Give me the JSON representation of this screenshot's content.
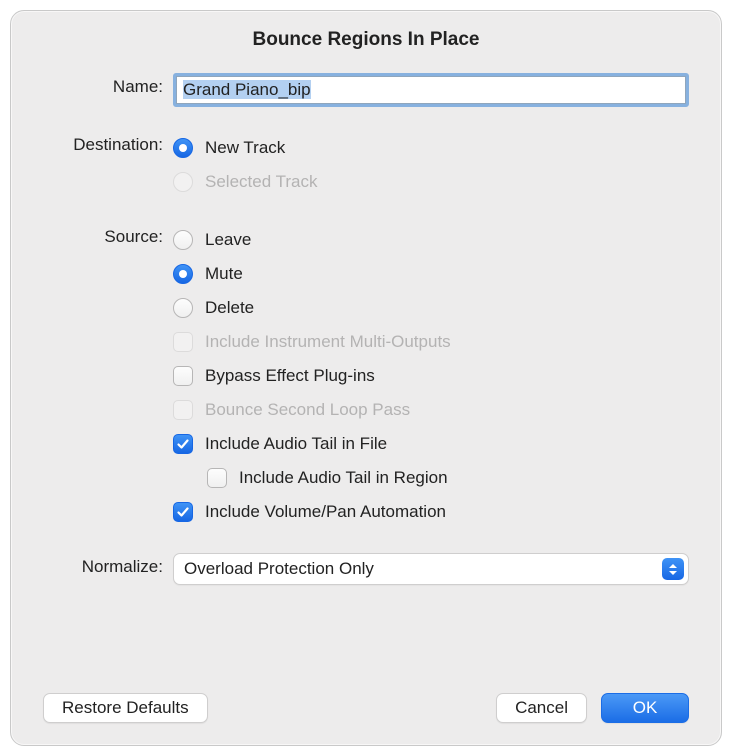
{
  "title": "Bounce Regions In Place",
  "name": {
    "label": "Name:",
    "value": "Grand Piano_bip"
  },
  "destination": {
    "label": "Destination:",
    "options": [
      {
        "key": "new-track",
        "label": "New Track",
        "checked": true,
        "disabled": false
      },
      {
        "key": "selected-track",
        "label": "Selected Track",
        "checked": false,
        "disabled": true
      }
    ]
  },
  "source": {
    "label": "Source:",
    "options": [
      {
        "key": "leave",
        "label": "Leave",
        "checked": false
      },
      {
        "key": "mute",
        "label": "Mute",
        "checked": true
      },
      {
        "key": "delete",
        "label": "Delete",
        "checked": false
      }
    ],
    "checkboxes": [
      {
        "key": "include-multi-outputs",
        "label": "Include Instrument Multi-Outputs",
        "checked": false,
        "disabled": true,
        "indent": false
      },
      {
        "key": "bypass-fx",
        "label": "Bypass Effect Plug-ins",
        "checked": false,
        "disabled": false,
        "indent": false
      },
      {
        "key": "second-loop",
        "label": "Bounce Second Loop Pass",
        "checked": false,
        "disabled": true,
        "indent": false
      },
      {
        "key": "tail-in-file",
        "label": "Include Audio Tail in File",
        "checked": true,
        "disabled": false,
        "indent": false
      },
      {
        "key": "tail-in-region",
        "label": "Include Audio Tail in Region",
        "checked": false,
        "disabled": false,
        "indent": true
      },
      {
        "key": "vol-pan-auto",
        "label": "Include Volume/Pan Automation",
        "checked": true,
        "disabled": false,
        "indent": false
      }
    ]
  },
  "normalize": {
    "label": "Normalize:",
    "value": "Overload Protection Only"
  },
  "buttons": {
    "restore_defaults": "Restore Defaults",
    "cancel": "Cancel",
    "ok": "OK"
  }
}
